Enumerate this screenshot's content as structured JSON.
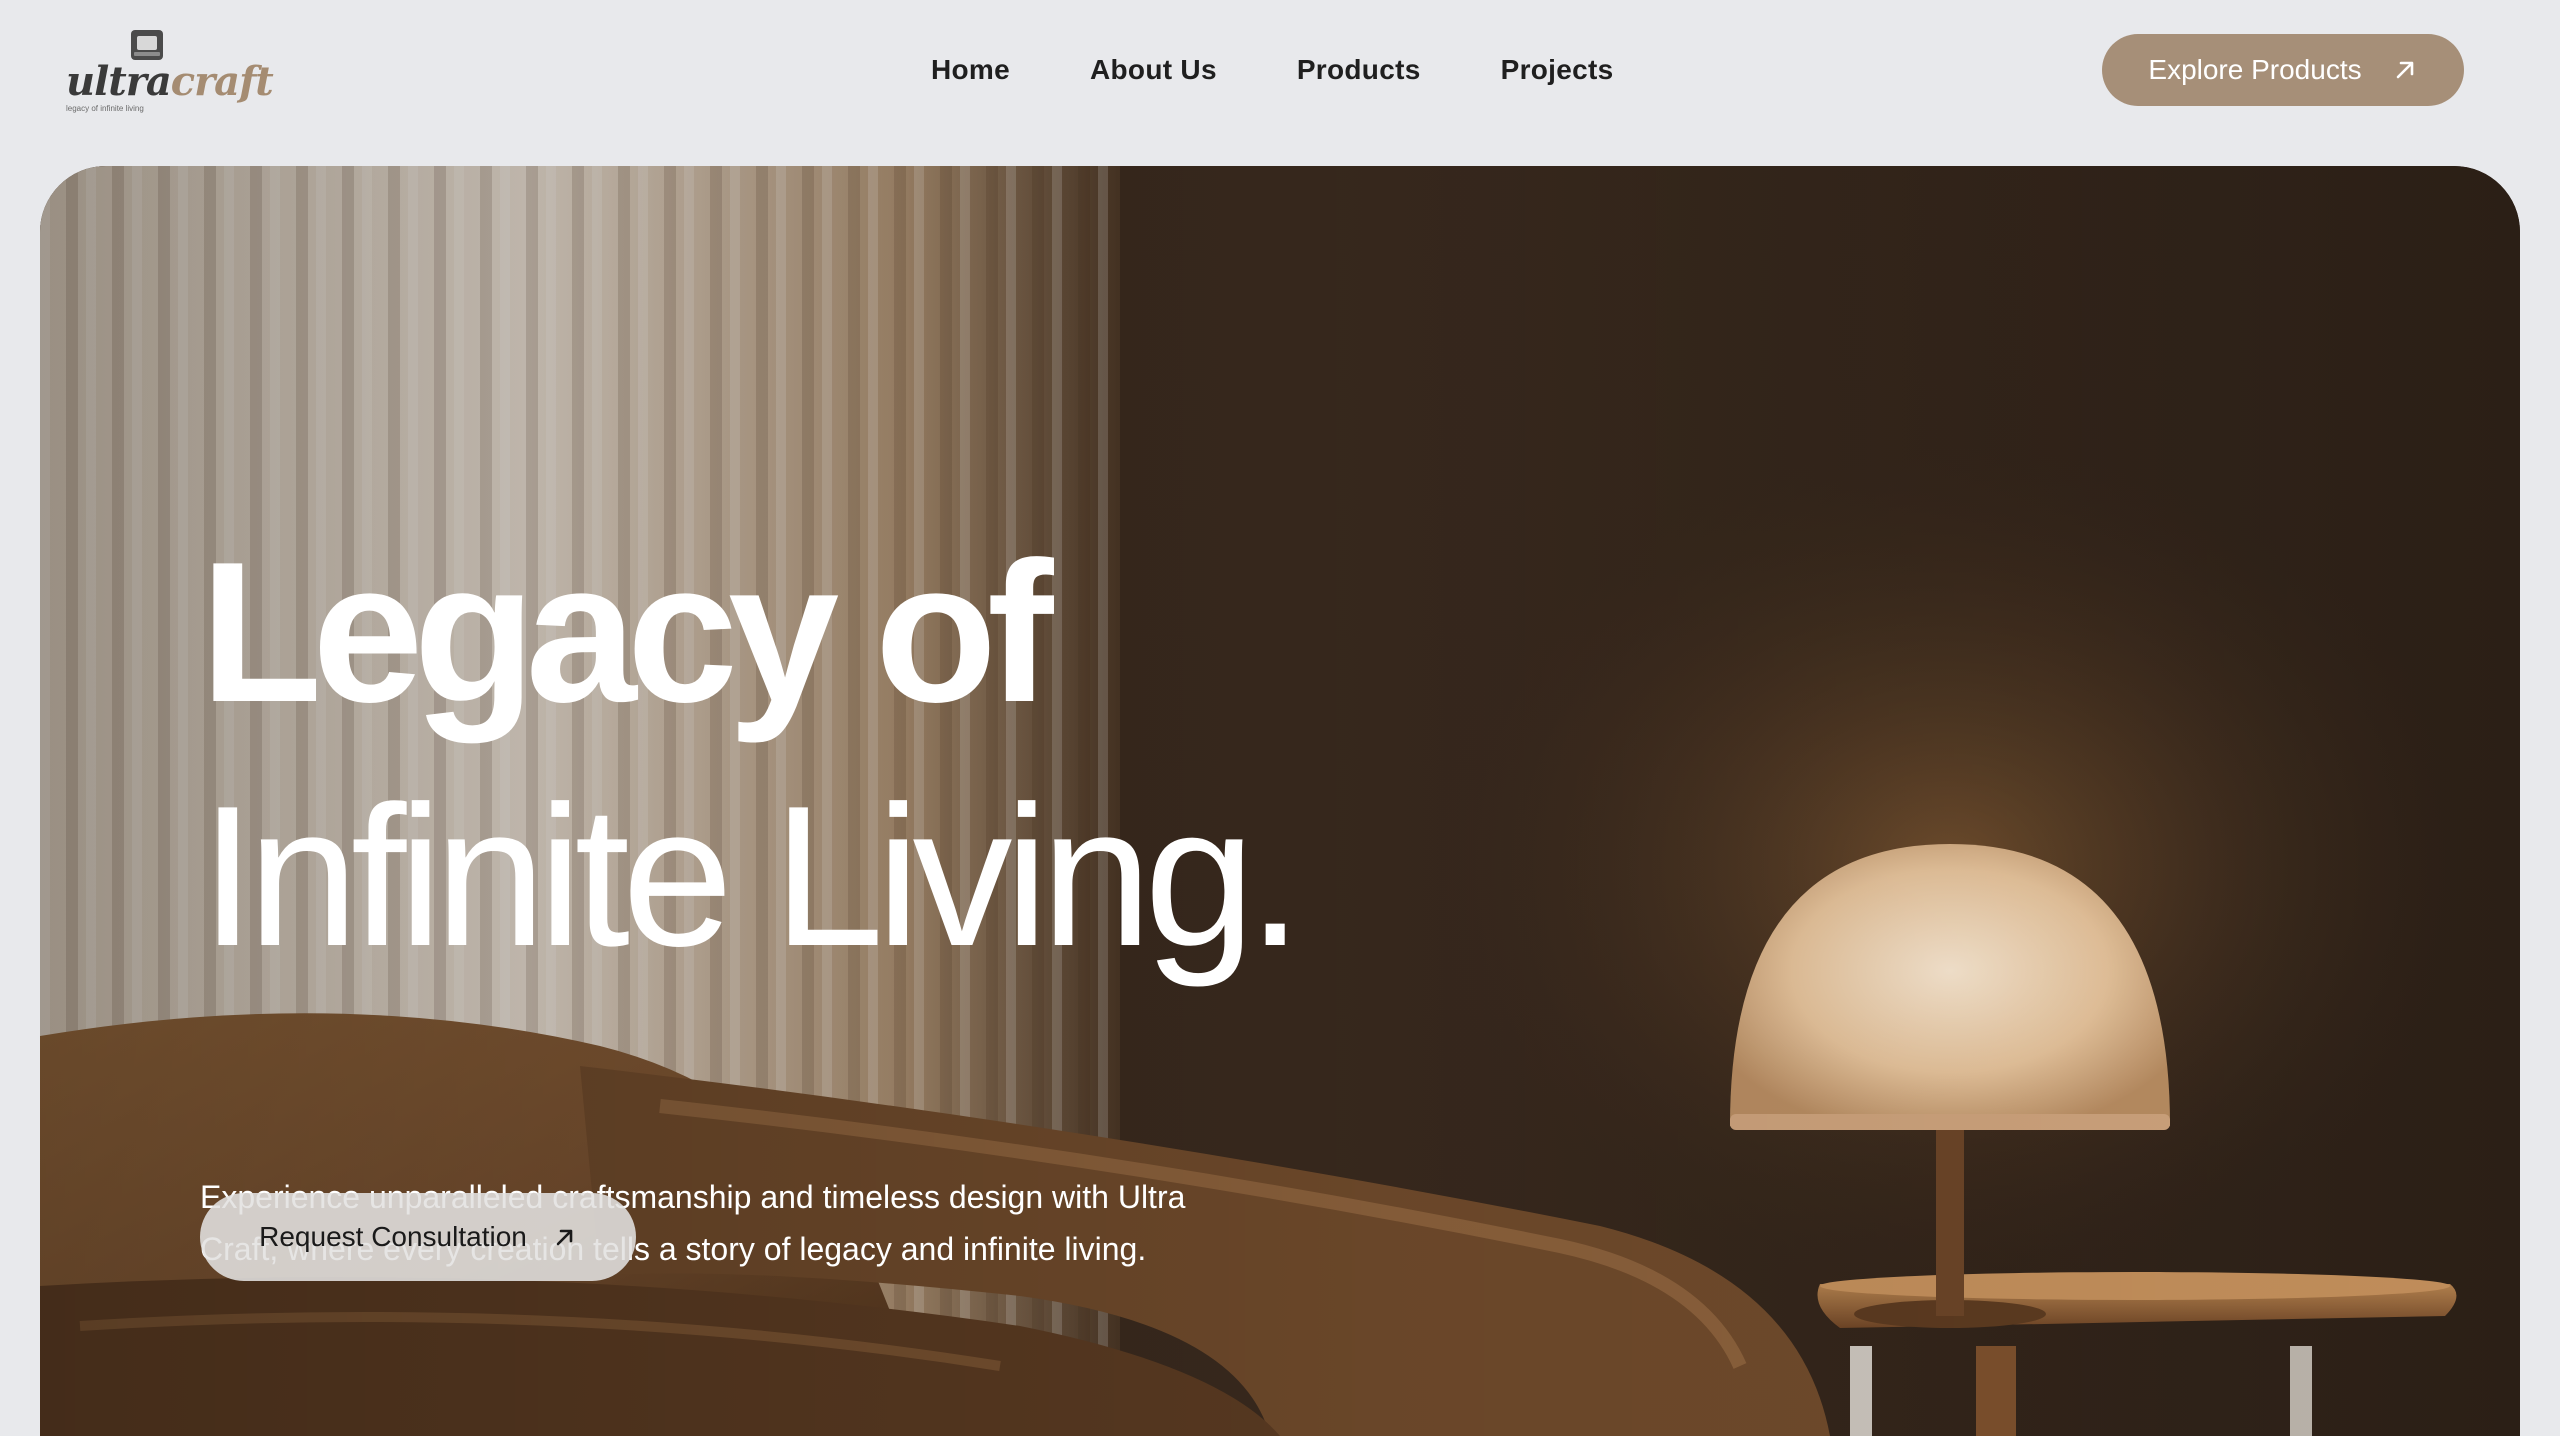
{
  "brand": {
    "wordmark_part1": "ultra",
    "wordmark_part2": "craft",
    "tagline": "legacy of infinite living"
  },
  "nav": {
    "items": [
      {
        "label": "Home"
      },
      {
        "label": "About Us"
      },
      {
        "label": "Products"
      },
      {
        "label": "Projects"
      }
    ]
  },
  "header": {
    "cta_label": "Explore Products",
    "cta_icon": "arrow-up-right-icon"
  },
  "hero": {
    "title_line1": "Legacy of",
    "title_line2": "Infinite Living.",
    "description": "Experience unparalleled craftsmanship and timeless design with Ultra Craft, where every creation tells a story of legacy and infinite living.",
    "cta_label": "Request Consultation",
    "cta_icon": "arrow-up-right-icon",
    "image_subject": "armchair-and-table-lamp"
  },
  "colors": {
    "page_background": "#e8e9ec",
    "accent": "#a68f78",
    "hero_text": "#ffffff",
    "nav_text": "#1f1f1f"
  }
}
